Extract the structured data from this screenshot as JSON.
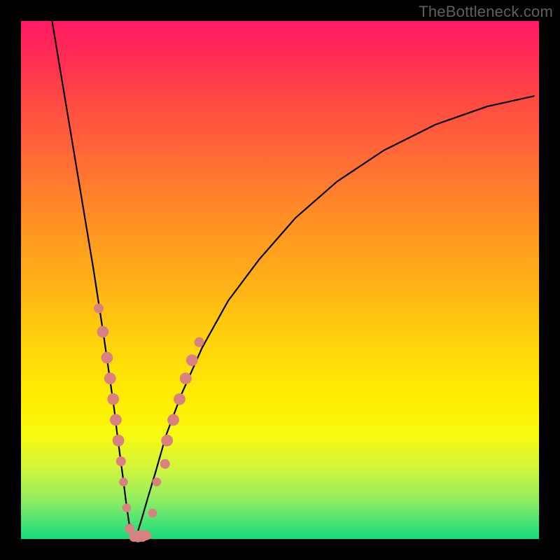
{
  "watermark": "TheBottleneck.com",
  "colors": {
    "background": "#000000",
    "curve": "#000000",
    "marker": "#d98181",
    "gradient_top": "#ff1a63",
    "gradient_bottom": "#17db7a"
  },
  "chart_data": {
    "type": "line",
    "title": "",
    "xlabel": "",
    "ylabel": "",
    "xlim": [
      0,
      100
    ],
    "ylim": [
      0,
      100
    ],
    "description": "Two black curves descending from the top toward a common valley near x≈21, y≈0, on a red-to-green vertical heat gradient. Pinkish circular markers cluster along both curve branches between roughly y=12 and y=30, with a few at the valley bottom.",
    "series": [
      {
        "name": "left-branch",
        "x": [
          6,
          8,
          10,
          12,
          14,
          16,
          17,
          18,
          18.6,
          19.2,
          19.8,
          20.3,
          20.8,
          21.2,
          21.6
        ],
        "y": [
          100,
          88,
          76,
          64,
          52,
          39,
          32,
          25,
          20,
          15.5,
          11,
          7,
          3.5,
          1.2,
          0.2
        ]
      },
      {
        "name": "right-branch",
        "x": [
          22.0,
          22.6,
          23.4,
          24.5,
          26,
          28,
          31,
          35,
          40,
          46,
          53,
          61,
          70,
          80,
          90,
          99
        ],
        "y": [
          0.2,
          1.6,
          4.2,
          8,
          13,
          20,
          28,
          37,
          46,
          54,
          62,
          69,
          75,
          80,
          83.5,
          85.5
        ]
      }
    ],
    "markers": [
      {
        "x": 15.0,
        "y": 44.5,
        "r": 1.0
      },
      {
        "x": 15.8,
        "y": 40.0,
        "r": 1.2
      },
      {
        "x": 16.6,
        "y": 35.0,
        "r": 1.2
      },
      {
        "x": 17.2,
        "y": 31.0,
        "r": 1.2
      },
      {
        "x": 17.8,
        "y": 27.0,
        "r": 1.2
      },
      {
        "x": 18.3,
        "y": 23.0,
        "r": 1.2
      },
      {
        "x": 18.8,
        "y": 19.0,
        "r": 1.2
      },
      {
        "x": 19.3,
        "y": 15.0,
        "r": 1.0
      },
      {
        "x": 19.8,
        "y": 11.0,
        "r": 0.9
      },
      {
        "x": 20.4,
        "y": 6.0,
        "r": 0.9
      },
      {
        "x": 21.0,
        "y": 2.0,
        "r": 1.0
      },
      {
        "x": 21.8,
        "y": 0.4,
        "r": 1.0
      },
      {
        "x": 22.6,
        "y": 0.5,
        "r": 1.2
      },
      {
        "x": 23.4,
        "y": 0.6,
        "r": 1.2
      },
      {
        "x": 24.2,
        "y": 0.7,
        "r": 1.0
      },
      {
        "x": 25.4,
        "y": 5.0,
        "r": 0.9
      },
      {
        "x": 26.2,
        "y": 11.0,
        "r": 0.9
      },
      {
        "x": 27.8,
        "y": 14.5,
        "r": 1.0
      },
      {
        "x": 28.2,
        "y": 19.0,
        "r": 1.2
      },
      {
        "x": 29.4,
        "y": 23.0,
        "r": 1.2
      },
      {
        "x": 30.6,
        "y": 27.0,
        "r": 1.2
      },
      {
        "x": 31.8,
        "y": 31.0,
        "r": 1.2
      },
      {
        "x": 33.0,
        "y": 34.5,
        "r": 1.2
      },
      {
        "x": 34.4,
        "y": 38.0,
        "r": 1.0
      }
    ]
  }
}
